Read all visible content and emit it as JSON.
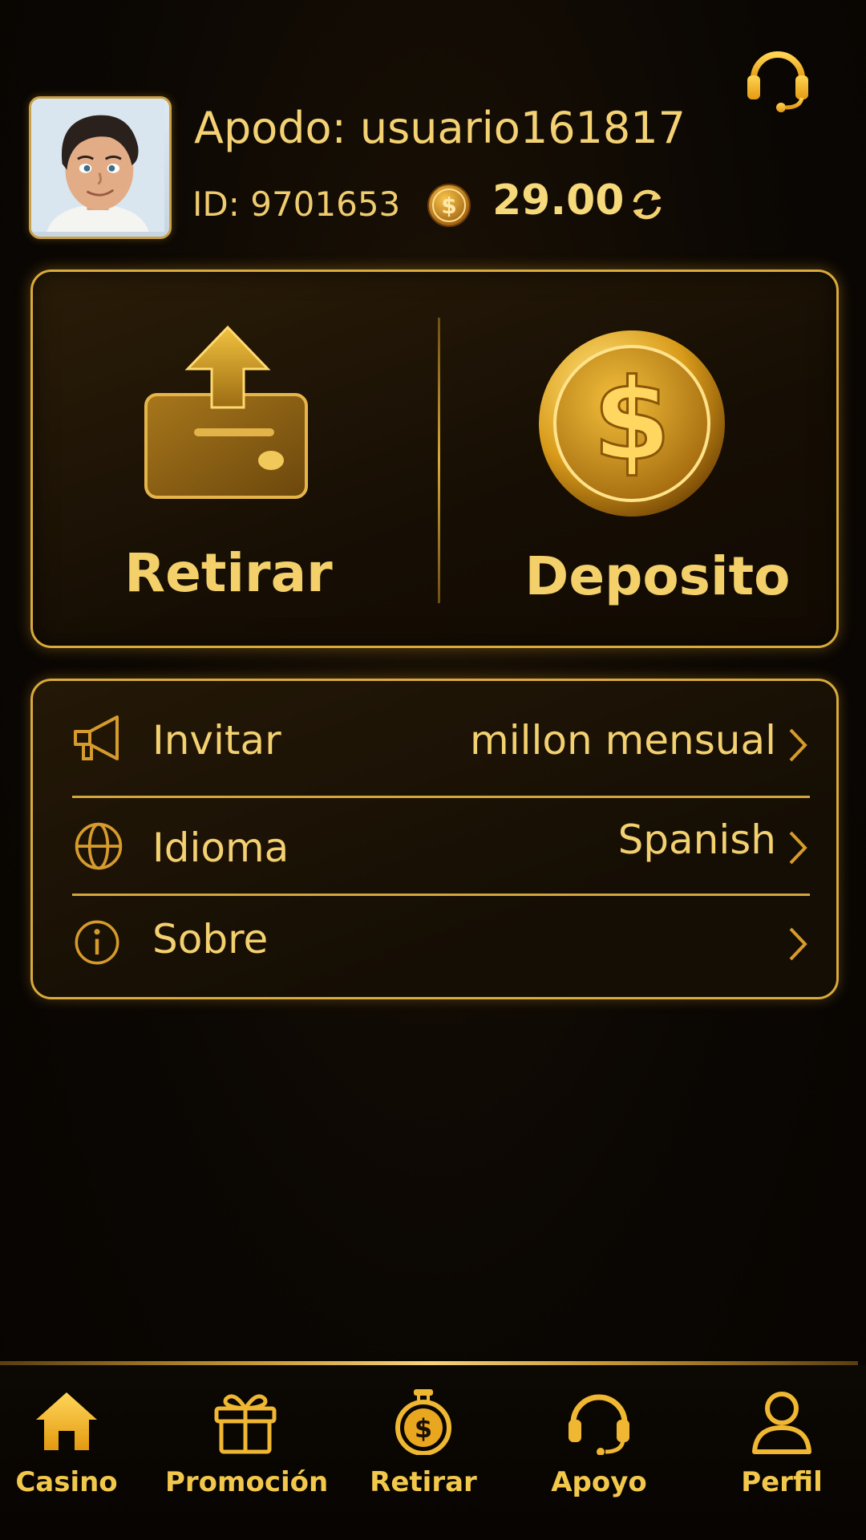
{
  "header": {
    "nickname": "Apodo: usuario161817",
    "user_id": "ID: 9701653",
    "balance": "29.00",
    "icons": [
      "headset-icon",
      "coin-icon",
      "refresh-icon"
    ]
  },
  "actions": {
    "withdraw_label": "Retirar",
    "deposit_label": "Deposito"
  },
  "menu": {
    "items": [
      {
        "label": "Invitar",
        "value": "millon mensual",
        "icon": "megaphone-icon"
      },
      {
        "label": "Idioma",
        "value": "Spanish",
        "icon": "globe-icon"
      },
      {
        "label": "Sobre",
        "value": "",
        "icon": "info-icon"
      }
    ]
  },
  "nav": {
    "items": [
      {
        "label": "Casino",
        "icon": "home-icon"
      },
      {
        "label": "Promoción",
        "icon": "gift-icon"
      },
      {
        "label": "Retirar",
        "icon": "money-bag-icon"
      },
      {
        "label": "Apoyo",
        "icon": "headset-icon"
      },
      {
        "label": "Perfil",
        "icon": "user-icon"
      }
    ]
  },
  "colors": {
    "accent_gold": "#f2cf6a",
    "border_gold": "#d9aa3c",
    "background": "#0b0703"
  }
}
